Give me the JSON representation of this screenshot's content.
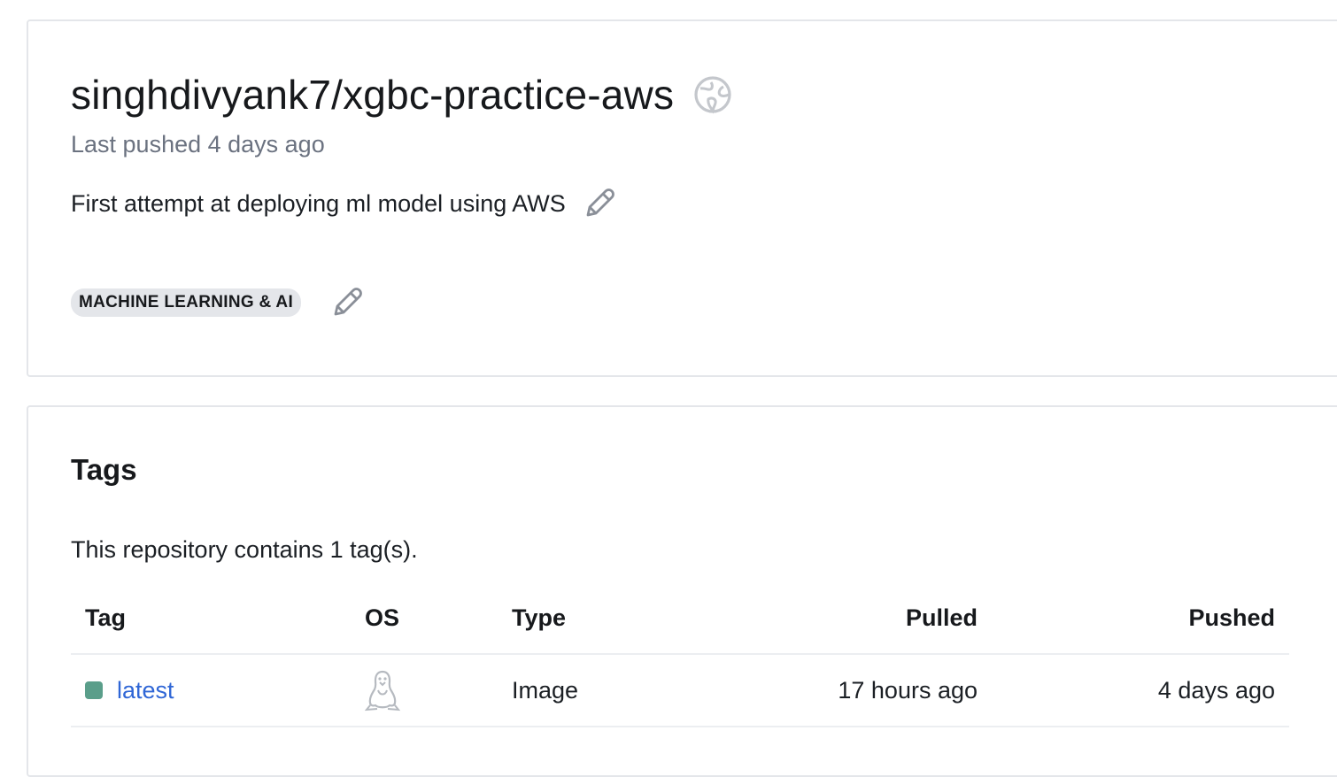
{
  "repo": {
    "title": "singhdivyank7/xgbc-practice-aws",
    "last_pushed": "Last pushed 4 days ago",
    "description": "First attempt at deploying ml model using AWS",
    "category": "MACHINE LEARNING & AI",
    "visibility_icon": "globe-icon",
    "edit_icon": "pencil-icon"
  },
  "tags": {
    "heading": "Tags",
    "summary": "This repository contains 1 tag(s).",
    "columns": {
      "tag": "Tag",
      "os": "OS",
      "type": "Type",
      "pulled": "Pulled",
      "pushed": "Pushed"
    },
    "rows": [
      {
        "tag": "latest",
        "os_icon": "linux-icon",
        "type": "Image",
        "pulled": "17 hours ago",
        "pushed": "4 days ago",
        "status_color": "#5a9e8a"
      }
    ]
  },
  "colors": {
    "link": "#2f66d6",
    "muted_text": "#6b7280",
    "chip_bg": "#e4e6ea",
    "border": "#e4e6ea"
  }
}
